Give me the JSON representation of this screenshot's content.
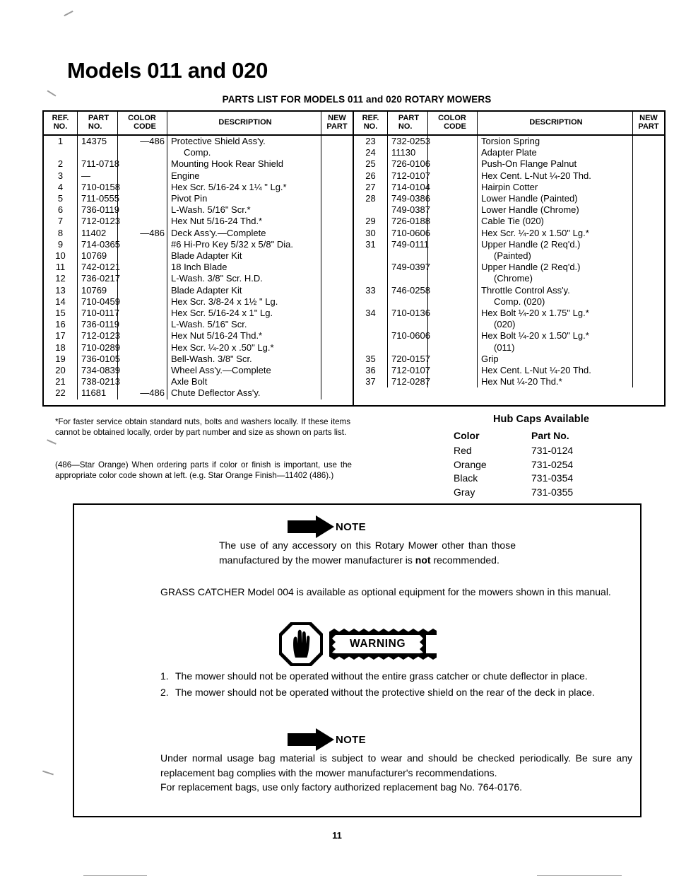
{
  "page": {
    "title": "Models 011 and 020",
    "subtitle": "PARTS LIST FOR MODELS 011 and 020  ROTARY MOWERS",
    "page_number": "11"
  },
  "table": {
    "headers": {
      "ref_no_l1": "REF.",
      "ref_no_l2": "NO.",
      "part_no_l1": "PART",
      "part_no_l2": "NO.",
      "color_code_l1": "COLOR",
      "color_code_l2": "CODE",
      "description": "DESCRIPTION",
      "new_part_l1": "NEW",
      "new_part_l2": "PART"
    },
    "left_rows": [
      {
        "ref": "1",
        "part": "14375",
        "color": "—486",
        "desc": "Protective Shield Ass'y.",
        "new": ""
      },
      {
        "ref": "",
        "part": "",
        "color": "",
        "desc": "     Comp.",
        "new": ""
      },
      {
        "ref": "2",
        "part": "711-0718",
        "color": "",
        "desc": "Mounting Hook Rear Shield",
        "new": ""
      },
      {
        "ref": "3",
        "part": "—",
        "color": "",
        "desc": "Engine",
        "new": ""
      },
      {
        "ref": "4",
        "part": "710-0158",
        "color": "",
        "desc": "Hex Scr. 5/16-24 x 1¼ \" Lg.*",
        "new": ""
      },
      {
        "ref": "5",
        "part": "711-0555",
        "color": "",
        "desc": "Pivot Pin",
        "new": ""
      },
      {
        "ref": "6",
        "part": "736-0119",
        "color": "",
        "desc": "L-Wash. 5/16\" Scr.*",
        "new": ""
      },
      {
        "ref": "7",
        "part": "712-0123",
        "color": "",
        "desc": "Hex Nut 5/16-24 Thd.*",
        "new": ""
      },
      {
        "ref": "8",
        "part": "11402",
        "color": "—486",
        "desc": "Deck Ass'y.—Complete",
        "new": ""
      },
      {
        "ref": "9",
        "part": "714-0365",
        "color": "",
        "desc": "#6 Hi-Pro Key 5/32 x 5/8\" Dia.",
        "new": ""
      },
      {
        "ref": "10",
        "part": "10769",
        "color": "",
        "desc": "Blade Adapter Kit",
        "new": ""
      },
      {
        "ref": "11",
        "part": "742-0121",
        "color": "",
        "desc": "18 Inch Blade",
        "new": ""
      },
      {
        "ref": "12",
        "part": "736-0217",
        "color": "",
        "desc": "L-Wash. 3/8\" Scr. H.D.",
        "new": ""
      },
      {
        "ref": "13",
        "part": "10769",
        "color": "",
        "desc": "Blade Adapter Kit",
        "new": ""
      },
      {
        "ref": "14",
        "part": "710-0459",
        "color": "",
        "desc": "Hex Scr. 3/8-24 x 1½ \" Lg.",
        "new": ""
      },
      {
        "ref": "15",
        "part": "710-0117",
        "color": "",
        "desc": "Hex Scr. 5/16-24 x 1\" Lg.",
        "new": ""
      },
      {
        "ref": "16",
        "part": "736-0119",
        "color": "",
        "desc": "L-Wash. 5/16\" Scr.",
        "new": ""
      },
      {
        "ref": "17",
        "part": "712-0123",
        "color": "",
        "desc": "Hex Nut 5/16-24 Thd.*",
        "new": ""
      },
      {
        "ref": "18",
        "part": "710-0289",
        "color": "",
        "desc": "Hex Scr. ¼-20 x .50\" Lg.*",
        "new": ""
      },
      {
        "ref": "19",
        "part": "736-0105",
        "color": "",
        "desc": "Bell-Wash. 3/8\" Scr.",
        "new": ""
      },
      {
        "ref": "20",
        "part": "734-0839",
        "color": "",
        "desc": "Wheel Ass'y.—Complete",
        "new": ""
      },
      {
        "ref": "21",
        "part": "738-0213",
        "color": "",
        "desc": "Axle Bolt",
        "new": ""
      },
      {
        "ref": "22",
        "part": "11681",
        "color": "—486",
        "desc": "Chute Deflector Ass'y.",
        "new": ""
      }
    ],
    "right_rows": [
      {
        "ref": "23",
        "part": "732-0253",
        "color": "",
        "desc": "Torsion Spring",
        "new": ""
      },
      {
        "ref": "24",
        "part": "11130",
        "color": "",
        "desc": "Adapter Plate",
        "new": ""
      },
      {
        "ref": "25",
        "part": "726-0106",
        "color": "",
        "desc": "Push-On Flange Palnut",
        "new": ""
      },
      {
        "ref": "26",
        "part": "712-0107",
        "color": "",
        "desc": "Hex Cent. L-Nut ¼-20 Thd.",
        "new": ""
      },
      {
        "ref": "27",
        "part": "714-0104",
        "color": "",
        "desc": "Hairpin Cotter",
        "new": ""
      },
      {
        "ref": "28",
        "part": "749-0386",
        "color": "",
        "desc": "Lower Handle (Painted)",
        "new": ""
      },
      {
        "ref": "",
        "part": "749-0387",
        "color": "",
        "desc": "Lower Handle (Chrome)",
        "new": ""
      },
      {
        "ref": "29",
        "part": "726-0188",
        "color": "",
        "desc": "Cable Tie (020)",
        "new": ""
      },
      {
        "ref": "30",
        "part": "710-0606",
        "color": "",
        "desc": "Hex Scr. ¼-20 x 1.50\" Lg.*",
        "new": ""
      },
      {
        "ref": "31",
        "part": "749-0111",
        "color": "",
        "desc": "Upper Handle (2 Req'd.)",
        "new": ""
      },
      {
        "ref": "",
        "part": "",
        "color": "",
        "desc": "     (Painted)",
        "new": ""
      },
      {
        "ref": "",
        "part": "749-0397",
        "color": "",
        "desc": "Upper Handle (2 Req'd.)",
        "new": ""
      },
      {
        "ref": "",
        "part": "",
        "color": "",
        "desc": "     (Chrome)",
        "new": ""
      },
      {
        "ref": "33",
        "part": "746-0258",
        "color": "",
        "desc": "Throttle Control Ass'y.",
        "new": ""
      },
      {
        "ref": "",
        "part": "",
        "color": "",
        "desc": "     Comp. (020)",
        "new": ""
      },
      {
        "ref": "34",
        "part": "710-0136",
        "color": "",
        "desc": "Hex Bolt ¼-20 x 1.75\" Lg.*",
        "new": ""
      },
      {
        "ref": "",
        "part": "",
        "color": "",
        "desc": "     (020)",
        "new": ""
      },
      {
        "ref": "",
        "part": "710-0606",
        "color": "",
        "desc": "Hex Bolt ¼-20 x 1.50\" Lg.*",
        "new": ""
      },
      {
        "ref": "",
        "part": "",
        "color": "",
        "desc": "     (011)",
        "new": ""
      },
      {
        "ref": "35",
        "part": "720-0157",
        "color": "",
        "desc": "Grip",
        "new": ""
      },
      {
        "ref": "36",
        "part": "712-0107",
        "color": "",
        "desc": "Hex Cent. L-Nut ¼-20 Thd.",
        "new": ""
      },
      {
        "ref": "37",
        "part": "712-0287",
        "color": "",
        "desc": "Hex Nut ¼-20 Thd.*",
        "new": ""
      }
    ]
  },
  "footnotes": {
    "fasteners": "*For faster service obtain standard nuts, bolts and washers locally. If these items cannot be obtained locally, order by part number and size as shown on parts list.",
    "color_code": "(486—Star Orange) When ordering parts if color or  finish is important, use the appropriate color code shown at  left. (e.g. Star Orange Finish—11402 (486).)"
  },
  "hubcaps": {
    "title": "Hub Caps Available",
    "header_color": "Color",
    "header_part": "Part No.",
    "rows": [
      {
        "color": "Red",
        "part": "731-0124"
      },
      {
        "color": "Orange",
        "part": "731-0254"
      },
      {
        "color": "Black",
        "part": "731-0354"
      },
      {
        "color": "Gray",
        "part": "731-0355"
      }
    ]
  },
  "notebox": {
    "note1_label": "NOTE",
    "note1_text_a": "The use of any accessory on this Rotary Mower other than those manufactured by the mower manufacturer is ",
    "note1_bold": "not",
    "note1_text_b": " recommended.",
    "grass_catcher": "GRASS CATCHER Model 004 is available as optional equipment for the mowers shown in this manual.",
    "warning_label": "WARNING",
    "warnings": [
      {
        "num": "1.",
        "text": "The mower should not be operated without the entire grass catcher or chute deflector in place."
      },
      {
        "num": "2.",
        "text": "The mower should not be operated without the protective shield on the rear of the deck in place."
      }
    ],
    "note2_label": "NOTE",
    "note2_para1": "Under normal usage bag material is subject to wear and should be checked periodically. Be sure any replacement bag complies with the mower manufacturer's recommendations.",
    "note2_para2": "For replacement bags, use only factory authorized replacement bag No. 764-0176."
  },
  "colors": {
    "ink": "#000000",
    "paper": "#ffffff"
  }
}
